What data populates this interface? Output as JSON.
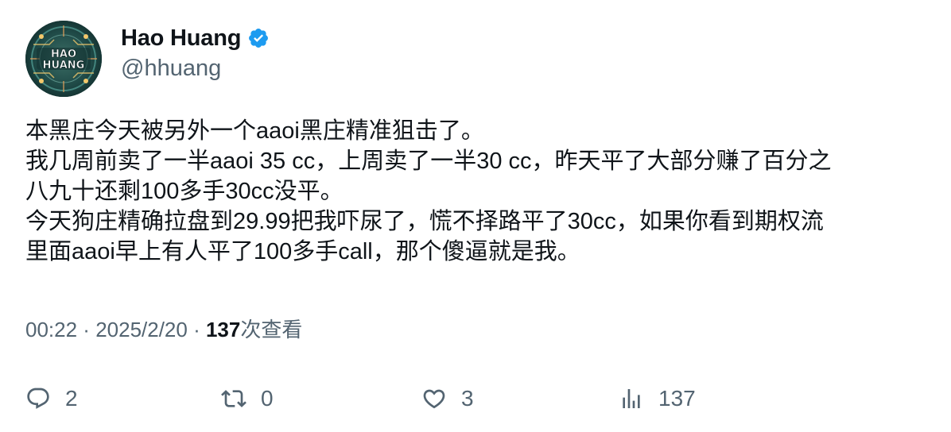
{
  "author": {
    "display_name": "Hao Huang",
    "handle": "@hhuang",
    "verified": true,
    "avatar_text": [
      "HAO",
      "HUANG"
    ]
  },
  "tweet": {
    "lines": [
      "本黑庄今天被另外一个aaoi黑庄精准狙击了。",
      "我几周前卖了一半aaoi 35 cc，上周卖了一半30 cc，昨天平了大部分赚了百分之",
      "八九十还剩100多手30cc没平。",
      "今天狗庄精确拉盘到29.99把我吓尿了，慌不择路平了30cc，如果你看到期权流",
      "里面aaoi早上有人平了100多手call，那个傻逼就是我。"
    ]
  },
  "meta": {
    "time": "00:22",
    "separator": " · ",
    "date": "2025/2/20",
    "views_count": "137",
    "views_label": "次查看"
  },
  "actions": {
    "replies": "2",
    "retweets": "0",
    "likes": "3",
    "views": "137"
  },
  "colors": {
    "text": "#0f1419",
    "secondary": "#536471",
    "verified": "#1d9bf0"
  },
  "icons": [
    "verified-badge-icon",
    "reply-icon",
    "retweet-icon",
    "like-icon",
    "views-icon"
  ]
}
